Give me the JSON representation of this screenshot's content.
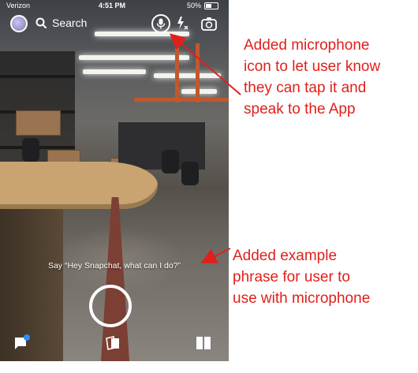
{
  "status_bar": {
    "carrier": "Verizon",
    "time": "4:51 PM",
    "battery": "50%"
  },
  "top_bar": {
    "search_label": "Search"
  },
  "voice_prompt": "Say “Hey Snapchat, what can I do?”",
  "annotations": {
    "microphone": "Added microphone\nicon to let user know\nthey can tap it and\nspeak to the App",
    "phrase": "Added example\nphrase for user to\nuse with microphone"
  },
  "icons": {
    "avatar": "bitmoji-avatar-icon",
    "search": "search-icon",
    "microphone": "microphone-icon",
    "flash": "flash-off-icon",
    "flip_camera": "flip-camera-icon",
    "chat": "chat-icon",
    "memories": "memories-icon",
    "stories": "stories-icon"
  },
  "colors": {
    "annotation": "#e0201b",
    "notification_dot": "#2d8cff"
  }
}
